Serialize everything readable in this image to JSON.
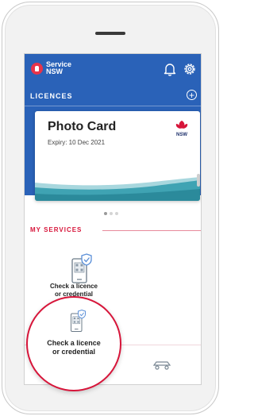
{
  "header": {
    "brand_line1": "Service",
    "brand_line2": "NSW"
  },
  "licences": {
    "section_title": "LICENCES",
    "card": {
      "title": "Photo Card",
      "expiry": "Expiry: 10 Dec 2021",
      "issuer_logo_text": "NSW"
    },
    "carousel": {
      "pages": 3,
      "active_index": 0
    }
  },
  "services": {
    "section_title": "MY SERVICES",
    "tile": {
      "label_line1": "Check a licence",
      "label_line2": "or credential"
    }
  },
  "magnifier": {
    "label_line1": "Check a licence",
    "label_line2": "or credential"
  },
  "colors": {
    "header_blue": "#2a62b8",
    "accent_red": "#d7153a",
    "wave_teal": "#3fa3b3"
  },
  "icons": {
    "logo": "service-nsw-logo-icon",
    "bell": "bell-icon",
    "gear": "gear-icon",
    "add": "plus-circle-icon",
    "service": "phone-check-icon",
    "bottom": "car-icon"
  }
}
